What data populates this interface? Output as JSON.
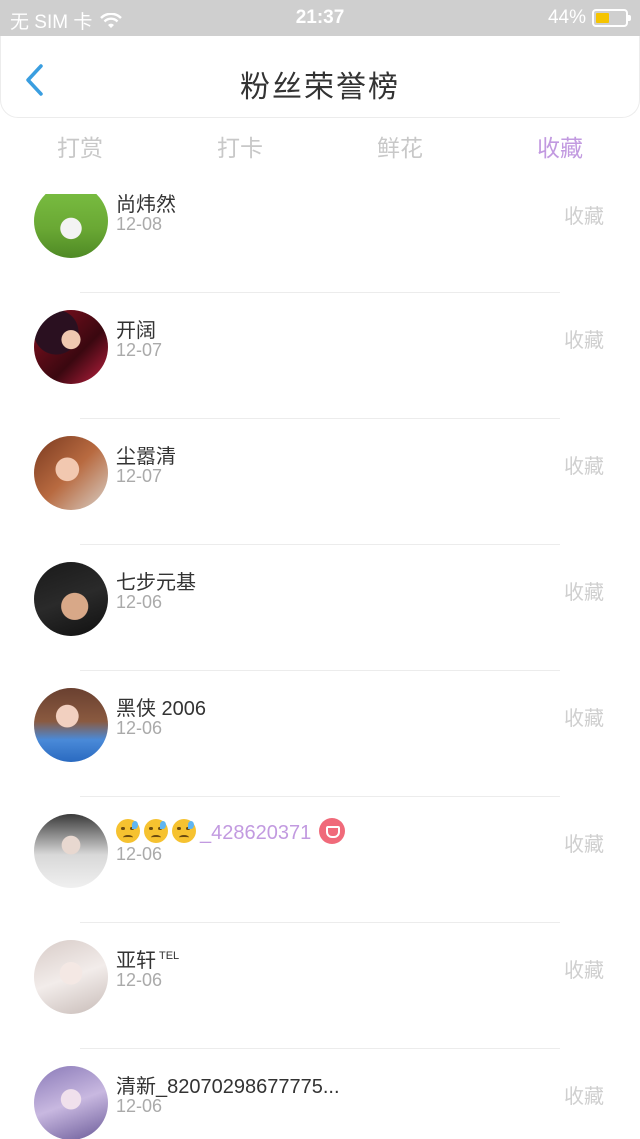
{
  "status_bar": {
    "carrier": "无 SIM 卡",
    "time": "21:37",
    "battery_percent": "44%",
    "battery_level": 0.44
  },
  "header": {
    "title": "粉丝荣誉榜"
  },
  "tabs": [
    {
      "label": "打赏",
      "active": false
    },
    {
      "label": "打卡",
      "active": false
    },
    {
      "label": "鲜花",
      "active": false
    },
    {
      "label": "收藏",
      "active": true
    }
  ],
  "list": [
    {
      "name": "尚炜然",
      "date": "12-08",
      "action": "收藏"
    },
    {
      "name": "开阔",
      "date": "12-07",
      "action": "收藏"
    },
    {
      "name": "尘嚣清",
      "date": "12-07",
      "action": "收藏"
    },
    {
      "name": "七步元基",
      "date": "12-06",
      "action": "收藏"
    },
    {
      "name": "黑侠 2006",
      "date": "12-06",
      "action": "收藏"
    },
    {
      "name": "_428620371",
      "date": "12-06",
      "action": "收藏"
    },
    {
      "name": "亚轩",
      "suffix": "TEL",
      "date": "12-06",
      "action": "收藏"
    },
    {
      "name": "清新_82070298677775...",
      "date": "12-06",
      "action": "收藏"
    }
  ],
  "colors": {
    "accent": "#c29ae0",
    "back_arrow": "#3a9ee0",
    "badge": "#f06a7a"
  }
}
